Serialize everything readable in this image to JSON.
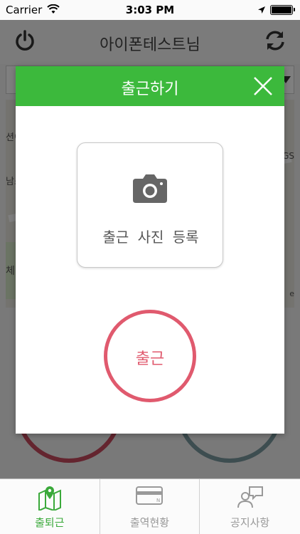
{
  "status_bar": {
    "carrier": "Carrier",
    "time": "3:03 PM"
  },
  "header": {
    "title": "아이폰테스트님",
    "icons": [
      "power-icon",
      "refresh-icon"
    ]
  },
  "map": {
    "labels": [
      "션이",
      "남소",
      "체",
      "GS",
      "e"
    ]
  },
  "modal": {
    "title": "출근하기",
    "photo_label": "출근 사진 등록",
    "checkin_label": "출근",
    "accent": "#3cb93c",
    "checkin_color": "#e05a6e"
  },
  "tabs": [
    {
      "label": "출퇴근",
      "icon": "map-pin-icon",
      "active": true
    },
    {
      "label": "출역현황",
      "icon": "card-icon",
      "active": false
    },
    {
      "label": "공지사항",
      "icon": "chat-person-icon",
      "active": false
    }
  ]
}
